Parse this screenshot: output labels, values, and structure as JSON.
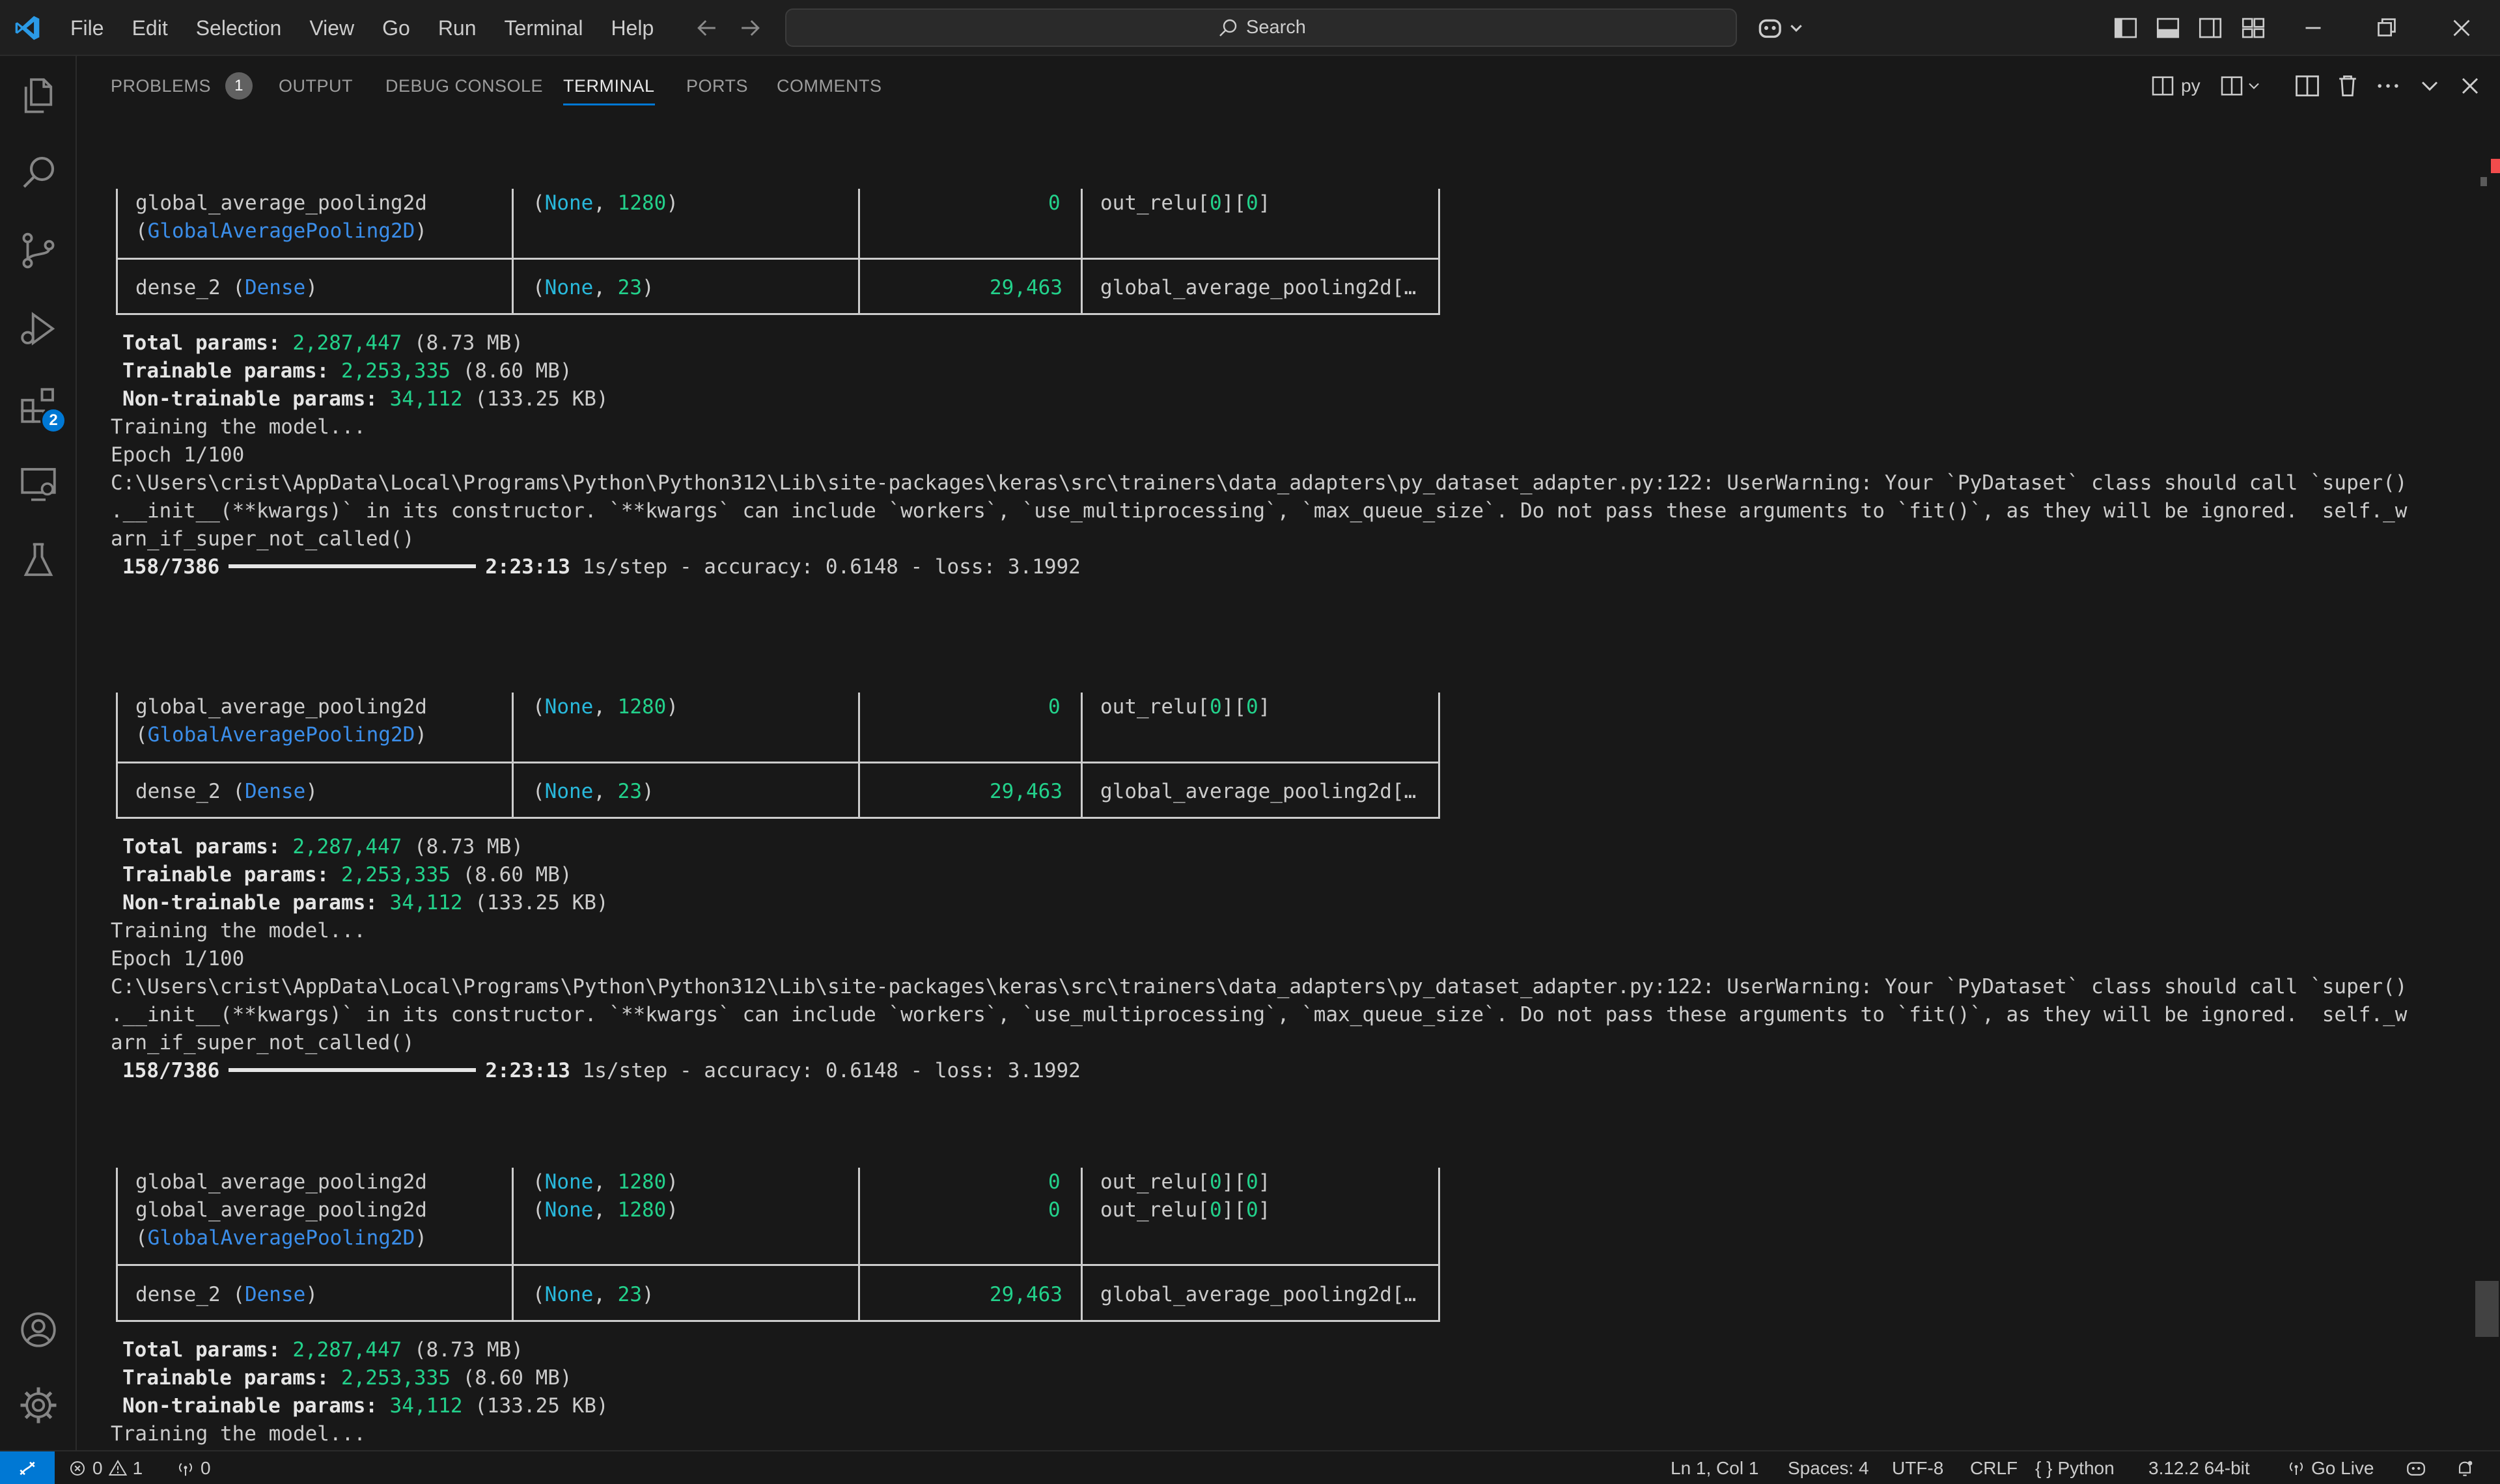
{
  "menu": [
    "File",
    "Edit",
    "Selection",
    "View",
    "Go",
    "Run",
    "Terminal",
    "Help"
  ],
  "search": {
    "label": "Search"
  },
  "panel": {
    "tabs": [
      "PROBLEMS",
      "OUTPUT",
      "DEBUG CONSOLE",
      "TERMINAL",
      "PORTS",
      "COMMENTS"
    ],
    "active_tab": "TERMINAL",
    "problems_count": "1",
    "terminal_name": "py"
  },
  "activity": {
    "extensions_badge": "2"
  },
  "terminal": {
    "layer_gap": "global_average_pooling2d",
    "layer_gap_class": "GlobalAveragePooling2D",
    "none": "None",
    "shape_1280": "1280",
    "shape_23": "23",
    "params_zero": "0",
    "params_dense": "29,463",
    "connected_out_relu_a": "out_relu[",
    "connected_zero": "0",
    "connected_out_relu_b": "][",
    "connected_out_relu_c": "]",
    "layer_dense": "dense_2",
    "layer_dense_class": "Dense",
    "connected_gap": "global_average_pooling2d[…",
    "total_label": "Total params:",
    "total_value": "2,287,447",
    "total_size": "(8.73 MB)",
    "trainable_label": "Trainable params:",
    "trainable_value": "2,253,335",
    "trainable_size": "(8.60 MB)",
    "nontrainable_label": "Non-trainable params:",
    "nontrainable_value": "34,112",
    "nontrainable_size": "(133.25 KB)",
    "training_msg": "Training the model...",
    "epoch": "Epoch 1/100",
    "warning_line1": "C:\\Users\\crist\\AppData\\Local\\Programs\\Python\\Python312\\Lib\\site-packages\\keras\\src\\trainers\\data_adapters\\py_dataset_adapter.py:122: UserWarning: Your `PyDataset` class should call `super()",
    "warning_line2": ".__init__(**kwargs)` in its constructor. `**kwargs` can include `workers`, `use_multiprocessing`, `max_queue_size`. Do not pass these arguments to `fit()`, as they will be ignored.  self._w",
    "warning_line3": "arn_if_super_not_called()",
    "progress_steps": "158/7386",
    "progress_fraction": 0.0214,
    "progress_eta": "2:23:13",
    "progress_rest": "1s/step - accuracy: 0.6148 - loss: 3.1992"
  },
  "status": {
    "errors": "0",
    "warnings": "1",
    "ports": "0",
    "position": "Ln 1, Col 1",
    "spaces": "Spaces: 4",
    "encoding": "UTF-8",
    "eol": "CRLF",
    "language": "Python",
    "interpreter": "3.12.2 64-bit",
    "golive": "Go Live"
  },
  "colors": {
    "accent": "#0078d4",
    "green": "#23d18b",
    "cyan": "#29b8db",
    "blue": "#3b8eea"
  }
}
